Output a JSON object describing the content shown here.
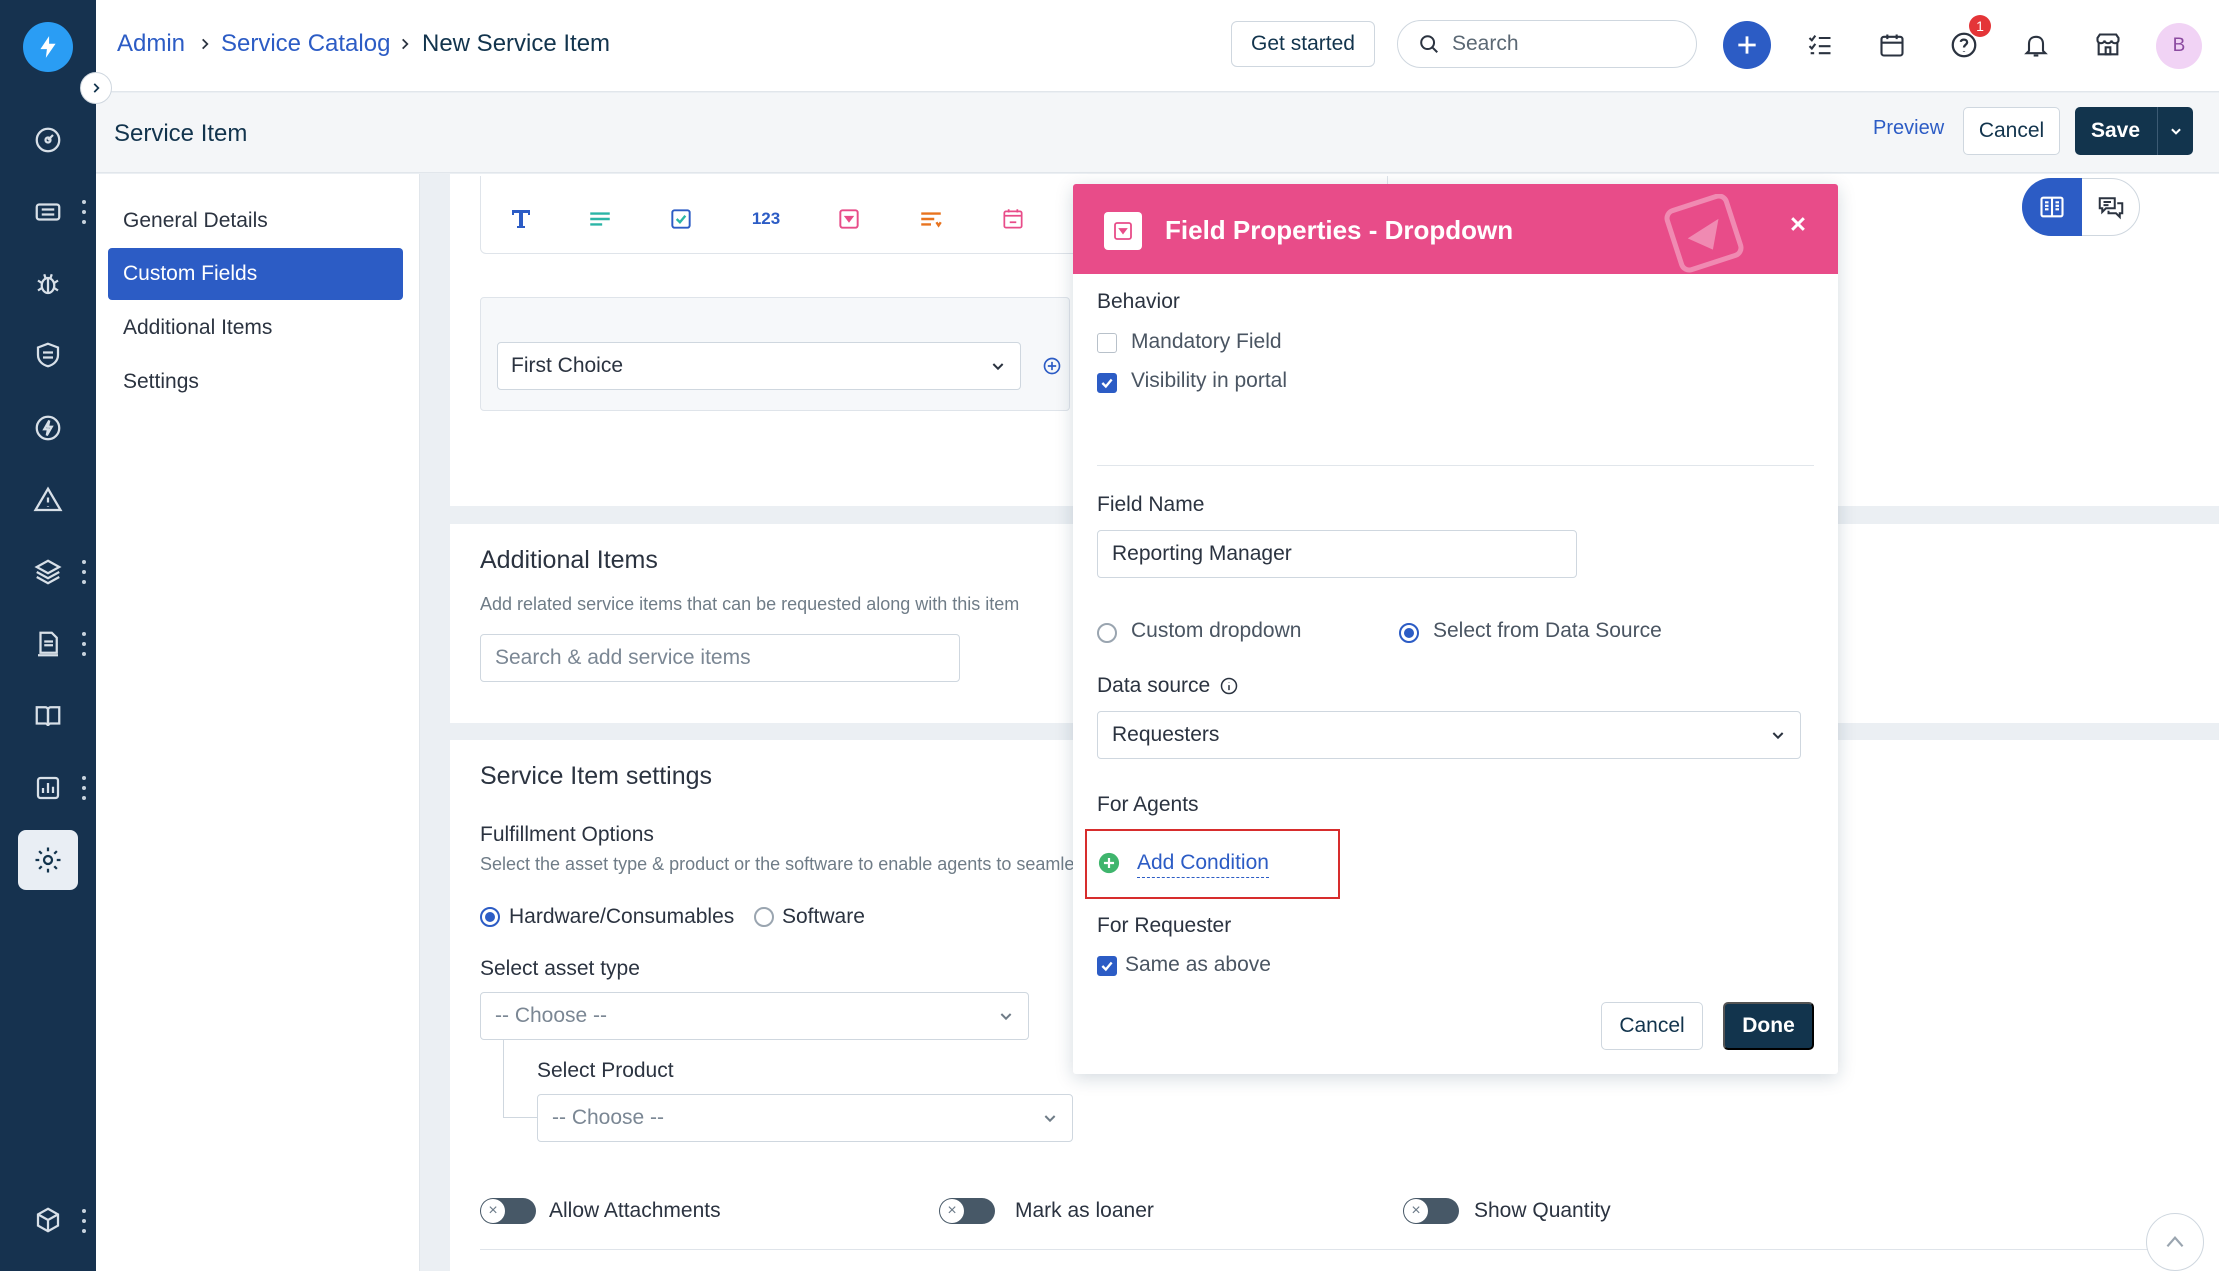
{
  "breadcrumb": {
    "items": [
      "Admin",
      "Service Catalog",
      "New Service Item"
    ]
  },
  "topbar": {
    "get_started": "Get started",
    "search_placeholder": "Search",
    "help_badge": "1",
    "avatar_initial": "B"
  },
  "header": {
    "title": "Service Item",
    "preview": "Preview",
    "cancel": "Cancel",
    "save": "Save"
  },
  "leftnav": {
    "items": [
      {
        "label": "General Details"
      },
      {
        "label": "Custom Fields"
      },
      {
        "label": "Additional Items"
      },
      {
        "label": "Settings"
      }
    ],
    "active": "Custom Fields"
  },
  "custom_fields": {
    "toolbar_number_label": "123",
    "preview_dropdown_value": "First Choice"
  },
  "additional_items": {
    "title": "Additional Items",
    "description": "Add related service items that can be requested along with this item",
    "search_placeholder": "Search & add service items"
  },
  "settings": {
    "title": "Service Item settings",
    "fulfillment_title": "Fulfillment Options",
    "fulfillment_desc": "Select the asset type & product or the software to enable agents to seamle",
    "options": [
      "Hardware/Consumables",
      "Software"
    ],
    "selected_option": "Hardware/Consumables",
    "asset_type_label": "Select asset type",
    "asset_type_value": "-- Choose --",
    "product_label": "Select Product",
    "product_value": "-- Choose --",
    "toggles": [
      "Allow Attachments",
      "Mark as loaner",
      "Show Quantity"
    ]
  },
  "modal": {
    "title": "Field Properties - Dropdown",
    "behavior_label": "Behavior",
    "mandatory_label": "Mandatory Field",
    "mandatory_checked": false,
    "visibility_label": "Visibility in portal",
    "visibility_checked": true,
    "field_name_label": "Field Name",
    "field_name_value": "Reporting Manager",
    "source_options": [
      "Custom dropdown",
      "Select from Data Source"
    ],
    "selected_source": "Select from Data Source",
    "data_source_label": "Data source",
    "data_source_value": "Requesters",
    "for_agents_label": "For Agents",
    "add_condition": "Add Condition",
    "for_requester_label": "For Requester",
    "same_as_above_label": "Same as above",
    "same_as_above_checked": true,
    "cancel": "Cancel",
    "done": "Done"
  },
  "colors": {
    "rail": "#16324f",
    "primary": "#2c5cc5",
    "dark_button": "#12344d",
    "modal_header": "#e84c89",
    "highlight_border": "#d72d2d",
    "add_condition_icon": "#3fb56d"
  },
  "icons": {
    "rail": [
      "logo-bolt-icon",
      "dashboard-icon",
      "tickets-icon",
      "problems-bug-icon",
      "changes-shield-icon",
      "releases-bolt-icon",
      "alerts-icon",
      "assets-layers-icon",
      "contracts-icon",
      "solutions-book-icon",
      "reports-icon",
      "admin-gear-icon",
      "apps-cube-icon"
    ]
  }
}
